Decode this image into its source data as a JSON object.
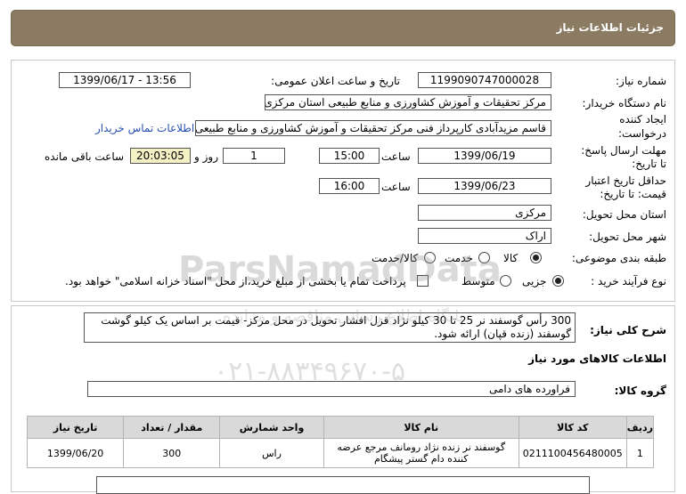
{
  "header": {
    "title": "جزئیات اطلاعات نیاز"
  },
  "fields": {
    "need_number_label": "شماره نیاز:",
    "need_number": "1199090747000028",
    "announce_label": "تاریخ و ساعت اعلان عمومی:",
    "announce_value": "1399/06/17 - 13:56",
    "buyer_label": "نام دستگاه خریدار:",
    "buyer_value": "مرکز تحقیقات و آموزش کشاورزی و منابع طبیعی استان مرکزی",
    "creator_label_1": "ایجاد کننده",
    "creator_label_2": "درخواست:",
    "creator_value": "قاسم مزیدآبادی کارپرداز فنی مرکز تحقیقات و آموزش کشاورزی و منابع طبیعی ا",
    "contact_link": "اطلاعات تماس خریدار",
    "deadline_label_1": "مهلت ارسال پاسخ:",
    "deadline_label_2": "تا تاریخ:",
    "deadline_date": "1399/06/19",
    "time_label": "ساعت",
    "deadline_time": "15:00",
    "days_value": "1",
    "days_label": "روز و",
    "remaining_time": "20:03:05",
    "remaining_label": "ساعت باقی مانده",
    "validity_label_1": "حداقل تاریخ اعتبار",
    "validity_label_2": "قیمت: تا تاریخ:",
    "validity_date": "1399/06/23",
    "validity_time": "16:00",
    "province_label": "استان محل تحویل:",
    "province_value": "مرکزی",
    "city_label": "شهر محل تحویل:",
    "city_value": "اراک",
    "category_label": "طبقه بندی موضوعی:",
    "category_options": [
      "کالا",
      "خدمت",
      "کالا/خدمت"
    ],
    "process_label": "نوع فرآیند خرید :",
    "process_options": [
      "جزیی",
      "متوسط"
    ],
    "payment_note": "پرداخت تمام یا بخشی از مبلغ خرید،از محل \"اسناد خزانه اسلامی\" خواهد بود."
  },
  "description": {
    "label": "شرح کلی نیاز:",
    "text": "300 رأس گوسفند نر 25 تا 30 کیلو نژاد قزل افشار تحویل در محل مرکز- قیمت بر اساس یک کیلو گوشت گوسفند (زنده قپان) ارائه شود."
  },
  "goods": {
    "section_title": "اطلاعات کالاهای مورد نیاز",
    "group_label": "گروه کالا:",
    "group_value": "فراورده های دامی",
    "columns": [
      "ردیف",
      "کد کالا",
      "نام کالا",
      "واحد شمارش",
      "مقدار / تعداد",
      "تاریخ نیاز"
    ],
    "rows": [
      [
        "1",
        "0211100456480005",
        "گوسفند نر زنده نژاد رومانف مرجع عرضه کننده دام گستر پیشگام",
        "راس",
        "300",
        "1399/06/20"
      ]
    ]
  },
  "watermark": {
    "line1": "ParsNamadData",
    "line2": "پایگاه اطلاع رسانی مناقصه و مزایده",
    "line3": "۰۲۱-۸۸۳۴۹۶۷۰-۵"
  }
}
